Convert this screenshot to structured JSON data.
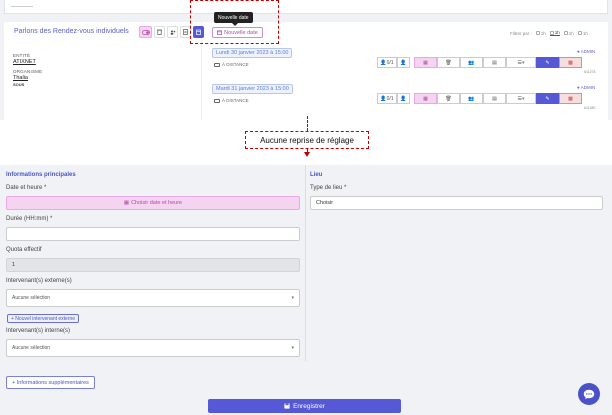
{
  "top_panel": {
    "card_title": "Parlons des Rendez-vous individuels",
    "toolbar": {
      "toggle_icon": "toggle-icon",
      "delete_icon": "trash-icon",
      "users_icon": "users-icon",
      "doc_icon": "document-icon",
      "active_icon": "calendar-icon"
    },
    "meta": {
      "entity_label": "ENTITÉ",
      "entity_value": "ATIXNET",
      "org_label": "ORGANISME",
      "org_value": "Thalia",
      "org_extra": "SOUS"
    },
    "new_date_button": "Nouvelle date",
    "tooltip": "Nouvelle date",
    "filter": {
      "label": "Filtrer par :",
      "options": [
        "1h",
        "1h",
        "1h",
        "1h"
      ]
    },
    "appointments": [
      {
        "date": "Lundi 30 janvier 2023 à 15:00",
        "location": "À DISTANCE",
        "count1": "0/1",
        "count2": "",
        "admin": "ADMIN",
        "id": "#11278"
      },
      {
        "date": "Mardi 31 janvier 2023 à 15:00",
        "location": "À DISTANCE",
        "count1": "0/1",
        "count2": "",
        "admin": "ADMIN",
        "id": "#11280"
      }
    ]
  },
  "callout": "Aucune reprise de réglage",
  "form": {
    "left_title": "Informations principales",
    "date_label": "Date et heure *",
    "date_button": "Choisir date et heure",
    "duration_label": "Durée (HH:mm) *",
    "duration_value": "",
    "quota_label": "Quota effectif",
    "quota_value": "1",
    "ext_label": "Intervenant(s) externe(s)",
    "ext_placeholder": "Aucune sélection",
    "ext_button": "+ Nouvel intervenant externe",
    "int_label": "Intervenant(s) interne(s)",
    "int_placeholder": "Aucune sélection",
    "right_title": "Lieu",
    "place_label": "Type de lieu *",
    "place_value": "Choisir",
    "more_info_button": "+ Informations supplémentaires",
    "save_button": "Enregistrer"
  },
  "colors": {
    "accent": "#5559d6",
    "pink": "#f4d4f1",
    "annotation": "#c00000"
  }
}
